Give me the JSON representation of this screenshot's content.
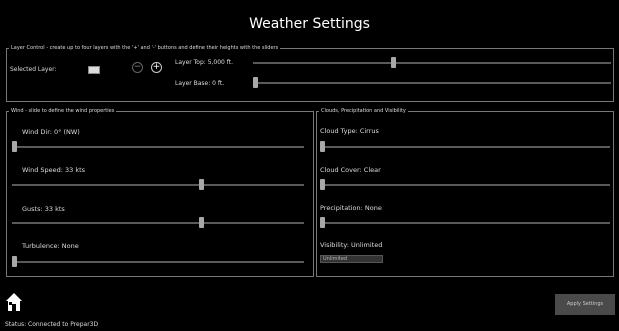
{
  "window": {
    "title": "Weather Settings"
  },
  "layer_control": {
    "legend": "Layer Control - create up to four layers with the '+' and '-' buttons and define their heights with the sliders",
    "selected_layer_label": "Selected Layer:",
    "minus_symbol": "−",
    "plus_symbol": "+",
    "layer_top_label": "Layer Top: 5,000 ft.",
    "layer_base_label": "Layer Base: 0 ft.",
    "layer_top_level": 0.39,
    "layer_base_level": 0.0
  },
  "wind": {
    "legend": "Wind - slide to define the wind properties",
    "direction_label": "Wind Dir: 0°  (NW)",
    "direction_level": 0.0,
    "speed_label": "Wind Speed: 33 kts",
    "speed_level": 0.65,
    "gusts_label": "Gusts: 33 kts",
    "gusts_level": 0.65,
    "turbulence_label": "Turbulence: None",
    "turbulence_level": 0.0
  },
  "clouds": {
    "legend": "Clouds, Precipitation and Visibility",
    "cloud_type_label": "Cloud Type: Cirrus",
    "cloud_type_level": 0.0,
    "cloud_cover_label": "Cloud Cover: Clear",
    "cloud_cover_level": 0.0,
    "precipitation_label": "Precipitation: None",
    "precipitation_level": 0.0,
    "visibility_label": "Visibility: Unlimited",
    "visibility_option": "Unlimited"
  },
  "footer": {
    "apply_label": "Apply Settings",
    "status": "Status: Connected to Prepar3D"
  },
  "icons": {
    "home": "home-icon"
  }
}
